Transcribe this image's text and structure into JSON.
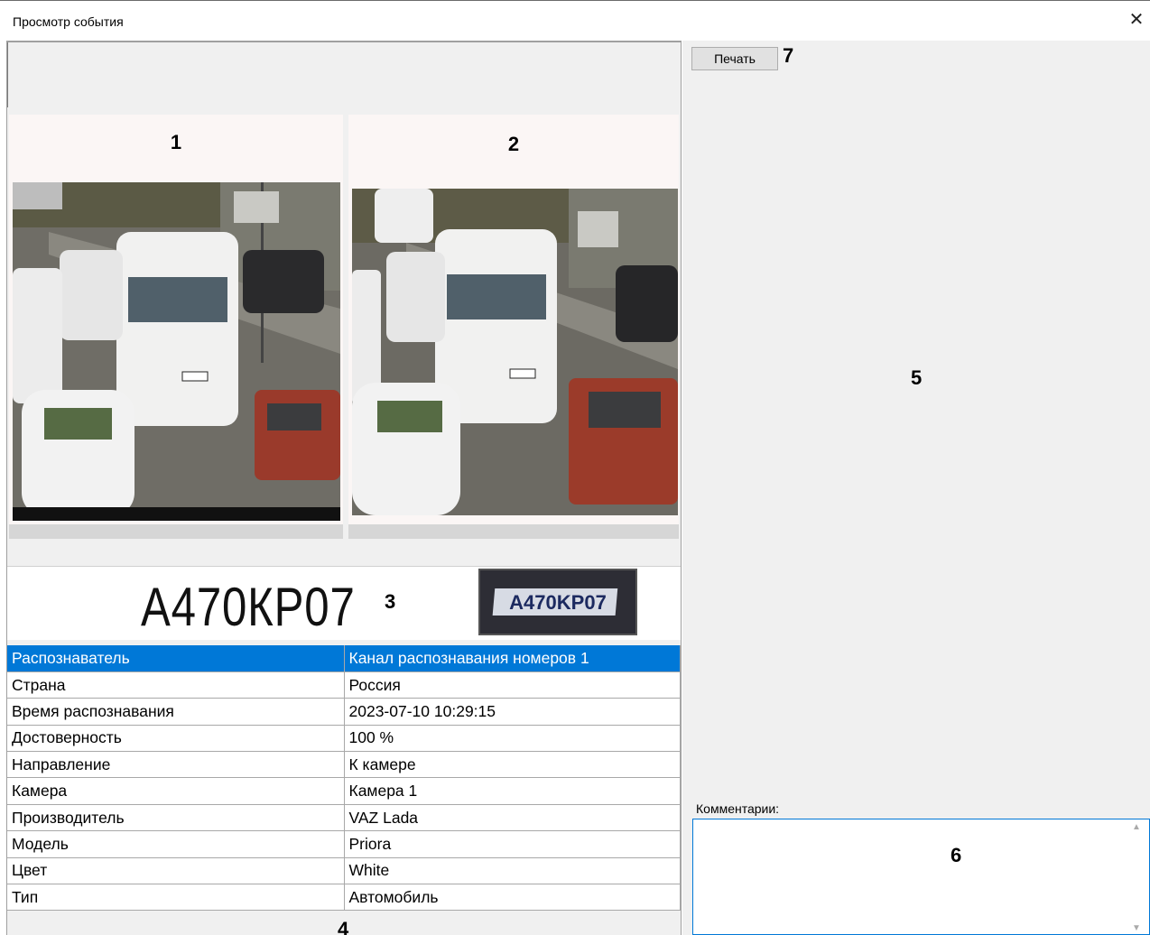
{
  "window": {
    "title": "Просмотр события"
  },
  "frames": [
    {
      "label": "1"
    },
    {
      "label": "2"
    }
  ],
  "plate": {
    "number": "А470КР07",
    "label": "3",
    "crop_text": "A470KP07"
  },
  "properties": [
    {
      "name": "Распознаватель",
      "value": "Канал распознавания номеров 1"
    },
    {
      "name": "Страна",
      "value": "Россия"
    },
    {
      "name": "Время распознавания",
      "value": "2023-07-10 10:29:15"
    },
    {
      "name": "Достоверность",
      "value": "100 %"
    },
    {
      "name": "Направление",
      "value": "К камере"
    },
    {
      "name": "Камера",
      "value": "Камера 1"
    },
    {
      "name": "Производитель",
      "value": "VAZ Lada"
    },
    {
      "name": "Модель",
      "value": "Priora"
    },
    {
      "name": "Цвет",
      "value": "White"
    },
    {
      "name": "Тип",
      "value": "Автомобиль"
    }
  ],
  "properties_label": "4",
  "right": {
    "print_label": "Печать",
    "print_marker": "7",
    "area_marker": "5",
    "comments_label": "Комментарии:",
    "comments_value": "",
    "comments_marker": "6"
  },
  "icons": {
    "close": "close-icon"
  },
  "colors": {
    "selection": "#0078d7",
    "pane_bg": "#f0f0f0"
  }
}
